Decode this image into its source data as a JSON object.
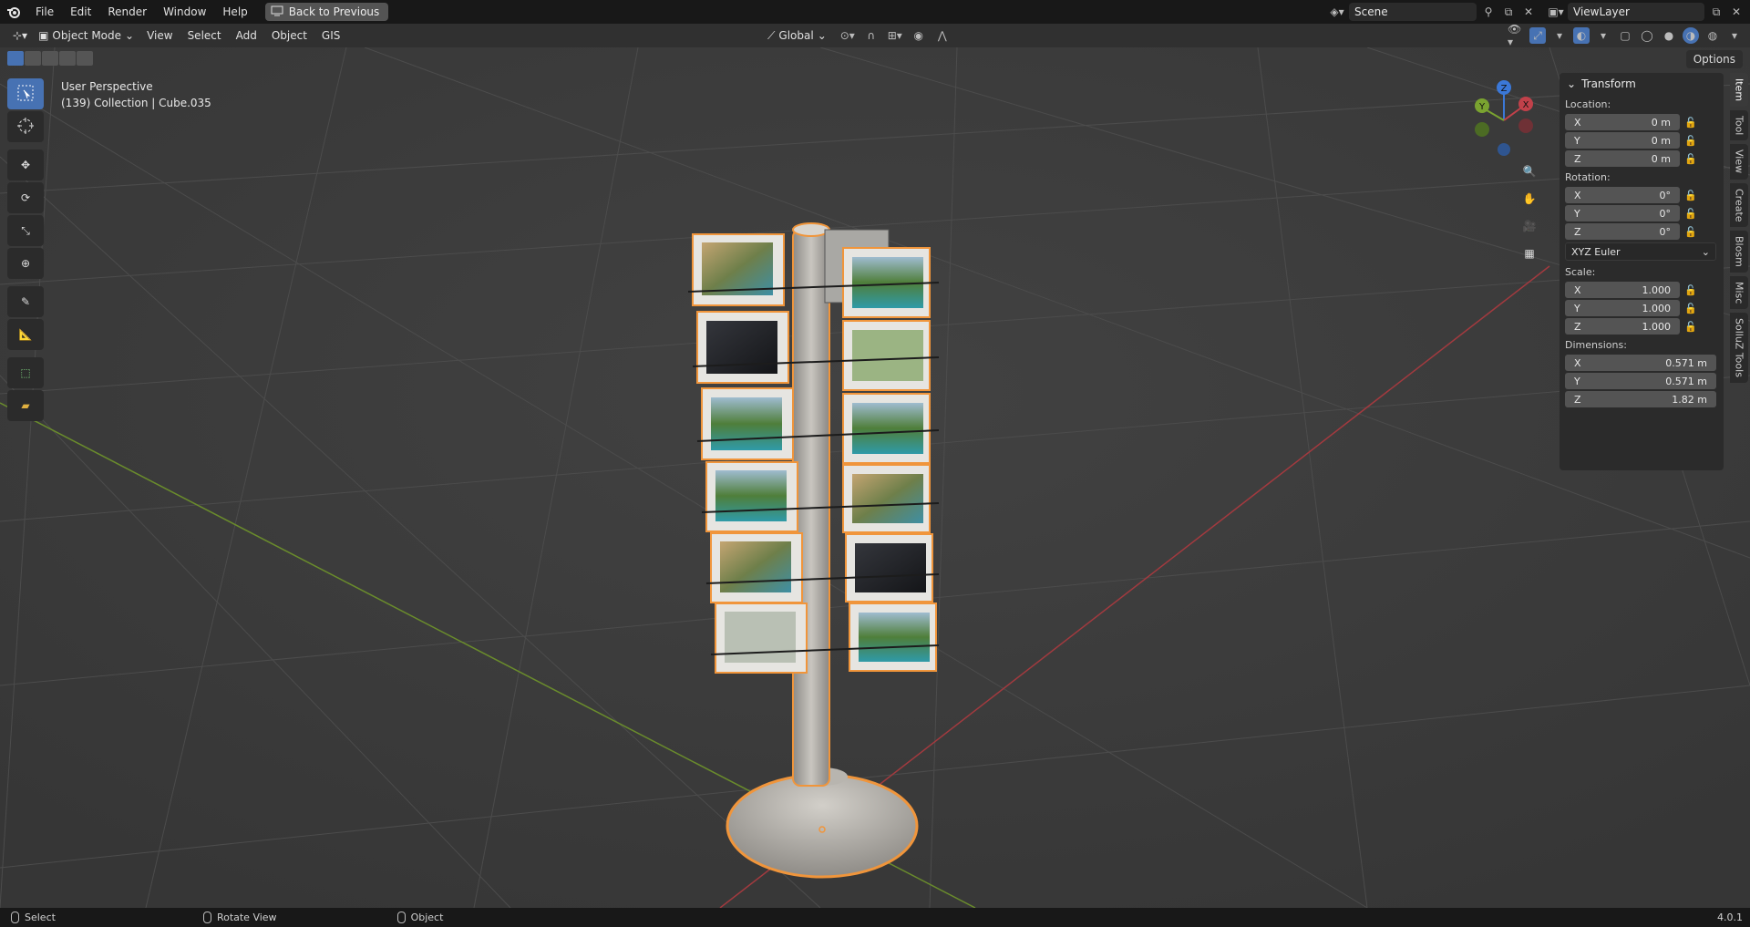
{
  "topbar": {
    "menus": [
      "File",
      "Edit",
      "Render",
      "Window",
      "Help"
    ],
    "back_label": "Back to Previous",
    "scene_name": "Scene",
    "viewlayer_name": "ViewLayer"
  },
  "header": {
    "mode": "Object Mode",
    "menus": [
      "View",
      "Select",
      "Add",
      "Object",
      "GIS"
    ],
    "orientation": "Global",
    "options_label": "Options"
  },
  "viewport": {
    "perspective": "User Perspective",
    "collection_info": "(139) Collection | Cube.035",
    "gizmo": {
      "x": "X",
      "y": "Y",
      "z": "Z"
    }
  },
  "npanel": {
    "title": "Transform",
    "location_label": "Location:",
    "location": [
      {
        "axis": "X",
        "value": "0 m"
      },
      {
        "axis": "Y",
        "value": "0 m"
      },
      {
        "axis": "Z",
        "value": "0 m"
      }
    ],
    "rotation_label": "Rotation:",
    "rotation": [
      {
        "axis": "X",
        "value": "0°"
      },
      {
        "axis": "Y",
        "value": "0°"
      },
      {
        "axis": "Z",
        "value": "0°"
      }
    ],
    "rotation_mode": "XYZ Euler",
    "scale_label": "Scale:",
    "scale": [
      {
        "axis": "X",
        "value": "1.000"
      },
      {
        "axis": "Y",
        "value": "1.000"
      },
      {
        "axis": "Z",
        "value": "1.000"
      }
    ],
    "dimensions_label": "Dimensions:",
    "dimensions": [
      {
        "axis": "X",
        "value": "0.571 m"
      },
      {
        "axis": "Y",
        "value": "0.571 m"
      },
      {
        "axis": "Z",
        "value": "1.82 m"
      }
    ]
  },
  "side_tabs": [
    "Item",
    "Tool",
    "View",
    "Create",
    "Blosm",
    "Misc",
    "SolluZ Tools"
  ],
  "statusbar": {
    "select": "Select",
    "rotate": "Rotate View",
    "object": "Object",
    "version": "4.0.1"
  },
  "colors": {
    "selection_outline": "#f0953b",
    "x_axis": "#c1414a",
    "y_axis": "#7aa330",
    "z_axis": "#3b78d8",
    "accent": "#4772b3"
  }
}
